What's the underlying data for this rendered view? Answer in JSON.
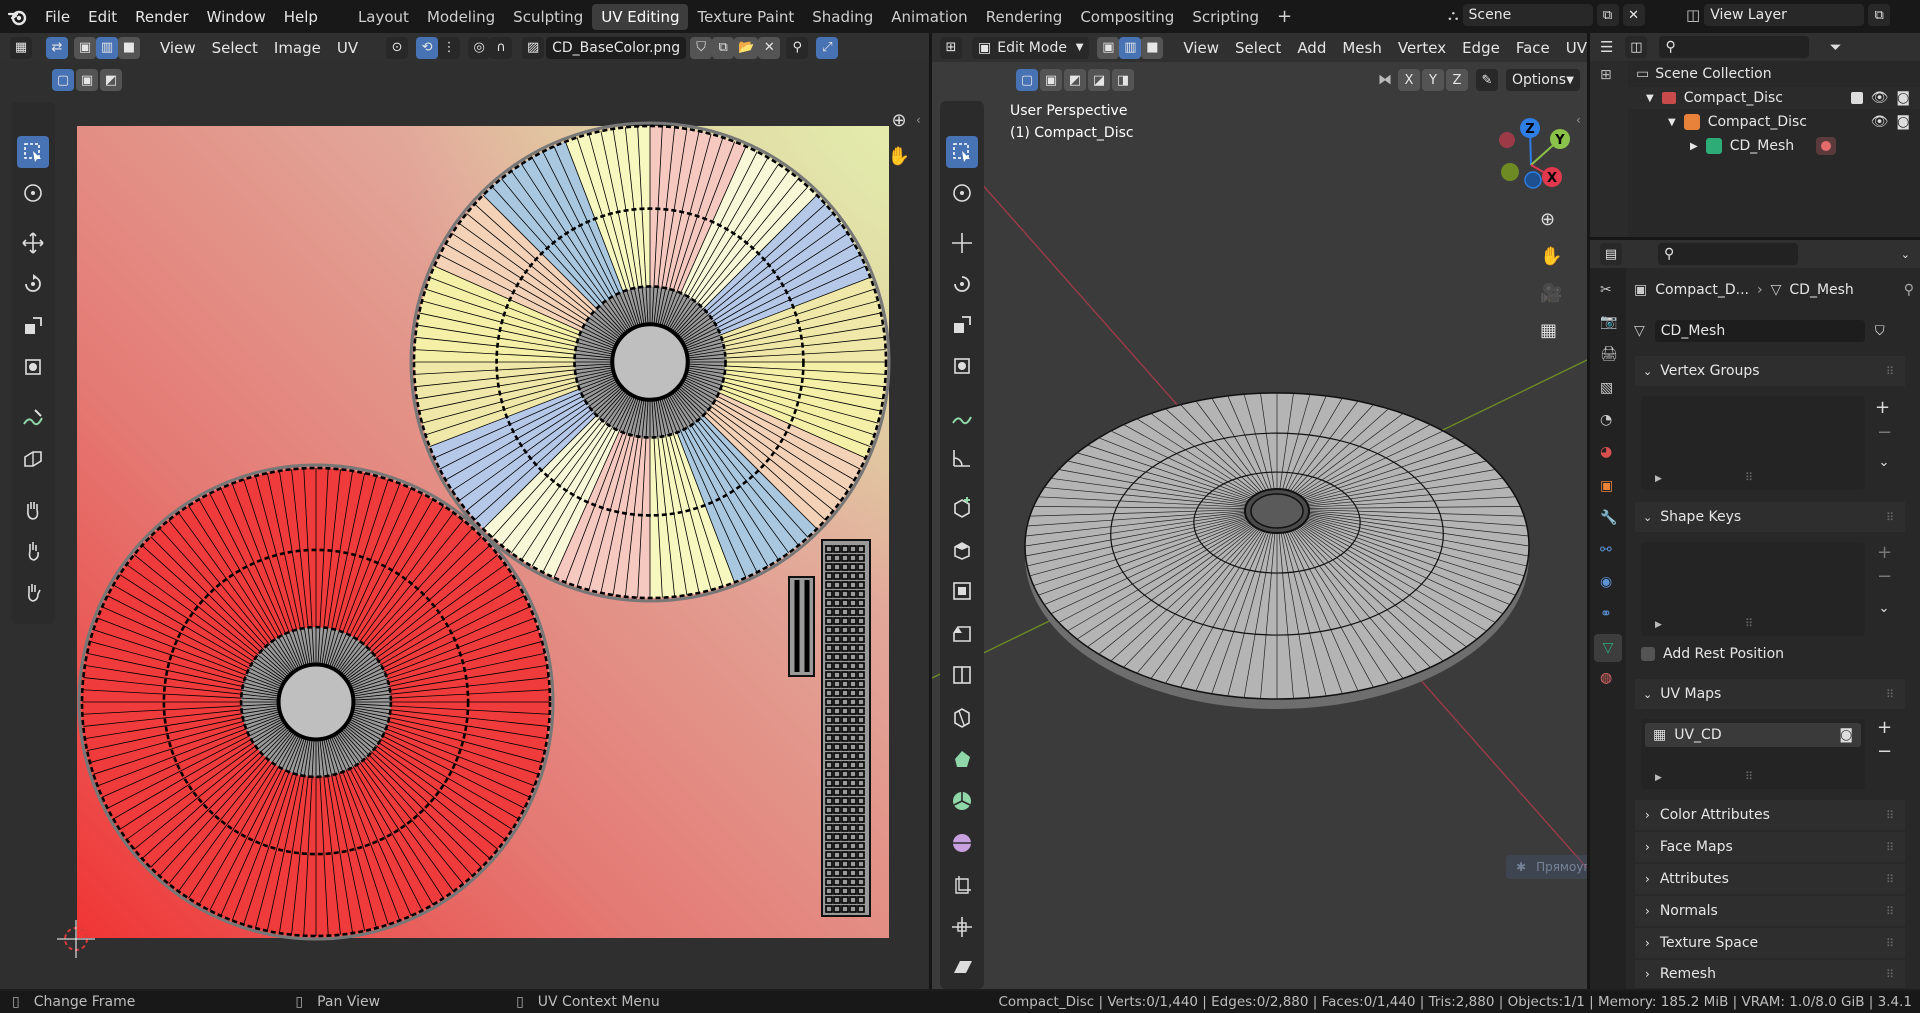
{
  "menubar": {
    "items": [
      "File",
      "Edit",
      "Render",
      "Window",
      "Help"
    ],
    "workspaces": [
      "Layout",
      "Modeling",
      "Sculpting",
      "UV Editing",
      "Texture Paint",
      "Shading",
      "Animation",
      "Rendering",
      "Compositing",
      "Scripting"
    ],
    "active_workspace": "UV Editing",
    "scene_label": "Scene",
    "view_layer_label": "View Layer"
  },
  "uv_editor": {
    "menus": [
      "View",
      "Select",
      "Image",
      "UV"
    ],
    "image_name": "CD_BaseColor.png"
  },
  "viewport": {
    "mode": "Edit Mode",
    "menus": [
      "View",
      "Select",
      "Add",
      "Mesh",
      "Vertex",
      "Edge",
      "Face",
      "UV"
    ],
    "axis_lock": [
      "X",
      "Y",
      "Z"
    ],
    "options_label": "Options",
    "overlay_title": "User Perspective",
    "overlay_object": "(1) Compact_Disc",
    "gizmo_axes": {
      "z": "Z",
      "y": "Y",
      "x": "X"
    },
    "tooltip_text": "Прямоугольник"
  },
  "outliner": {
    "collection": "Scene Collection",
    "items": [
      {
        "label": "Compact_Disc",
        "level": 0
      },
      {
        "label": "Compact_Disc",
        "level": 1
      },
      {
        "label": "CD_Mesh",
        "level": 2
      }
    ]
  },
  "properties": {
    "breadcrumb_object": "Compact_D...",
    "breadcrumb_mesh": "CD_Mesh",
    "mesh_name": "CD_Mesh",
    "panels": {
      "vertex_groups": "Vertex Groups",
      "shape_keys": "Shape Keys",
      "add_rest_position": "Add Rest Position",
      "uv_maps": "UV Maps",
      "uv_map_item": "UV_CD",
      "color_attributes": "Color Attributes",
      "face_maps": "Face Maps",
      "attributes": "Attributes",
      "normals": "Normals",
      "texture_space": "Texture Space",
      "remesh": "Remesh"
    }
  },
  "status": {
    "change_frame": "Change Frame",
    "pan_view": "Pan View",
    "uv_context_menu": "UV Context Menu",
    "stats": "Compact_Disc | Verts:0/1,440 | Edges:0/2,880 | Faces:0/1,440 | Tris:2,880 | Objects:1/1 | Memory: 185.2 MiB | VRAM: 1.0/8.0 GiB | 3.4.1"
  },
  "colors": {
    "accent_blue": "#4772b3",
    "header_bg": "#303030",
    "area_bg": "#2b2b2b",
    "axis_red": "#9c3a48",
    "axis_green": "#6d8a25",
    "gizmo_z": "#2e7ee6",
    "gizmo_y": "#8bc34a",
    "gizmo_x": "#e0394e"
  }
}
